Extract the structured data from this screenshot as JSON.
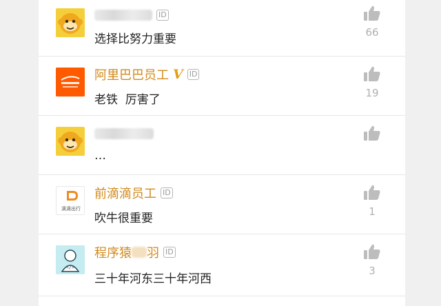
{
  "comments": [
    {
      "name": "",
      "name_blurred": true,
      "id_badge": "ID",
      "verified": false,
      "text": "选择比努力重要",
      "likes": "66",
      "avatar": "monkey-avatar"
    },
    {
      "name": "阿里巴巴员工",
      "name_blurred": false,
      "id_badge": "ID",
      "verified": true,
      "verified_mark": "V",
      "text": "老铁  厉害了",
      "likes": "19",
      "avatar": "alibaba-avatar"
    },
    {
      "name": "",
      "name_blurred": true,
      "id_badge": "",
      "verified": false,
      "text": "…",
      "likes": "",
      "avatar": "monkey-avatar"
    },
    {
      "name": "前滴滴员工",
      "name_blurred": false,
      "id_badge": "ID",
      "verified": false,
      "text": "吹牛很重要",
      "likes": "1",
      "avatar": "didi-avatar",
      "avatar_text": "滴滴出行"
    },
    {
      "name_prefix": "程序猿",
      "name_suffix": "羽",
      "name_blurred": true,
      "id_badge": "ID",
      "verified": false,
      "text": "三十年河东三十年河西",
      "likes": "3",
      "avatar": "programmer-avatar"
    }
  ],
  "colors": {
    "name": "#d2891a",
    "verified": "#e0a014",
    "text": "#222222",
    "like": "#bdbdbd"
  },
  "icons": [
    "thumbs-up-icon",
    "monkey-avatar",
    "alibaba-avatar",
    "didi-avatar",
    "programmer-avatar"
  ]
}
